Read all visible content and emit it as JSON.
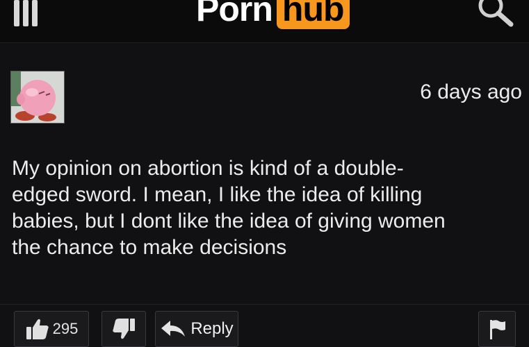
{
  "header": {
    "logo_part1": "Porn",
    "logo_part2": "hub",
    "menu_icon": "hamburger-menu-icon",
    "search_icon": "search-icon"
  },
  "comment": {
    "avatar_icon": "pink-character-avatar",
    "timestamp": "6 days ago",
    "text": "My opinion on abortion is kind of a double-edged sword. I mean, I like the idea of killing babies, but I dont like the idea of giving women the chance to make decisions",
    "lines": [
      "My opinion on abortion is kind of a double-",
      "edged sword. I mean, I like the idea of killing",
      "babies, but I dont like the idea of giving women",
      "the chance to make decisions"
    ]
  },
  "actions": {
    "like_icon": "thumbs-up-icon",
    "like_count": "295",
    "dislike_icon": "thumbs-down-icon",
    "reply_icon": "reply-arrow-icon",
    "reply_label": "Reply",
    "flag_icon": "flag-icon"
  },
  "colors": {
    "background": "#111113",
    "brand_accent": "#f7971d",
    "text": "#ececec"
  }
}
